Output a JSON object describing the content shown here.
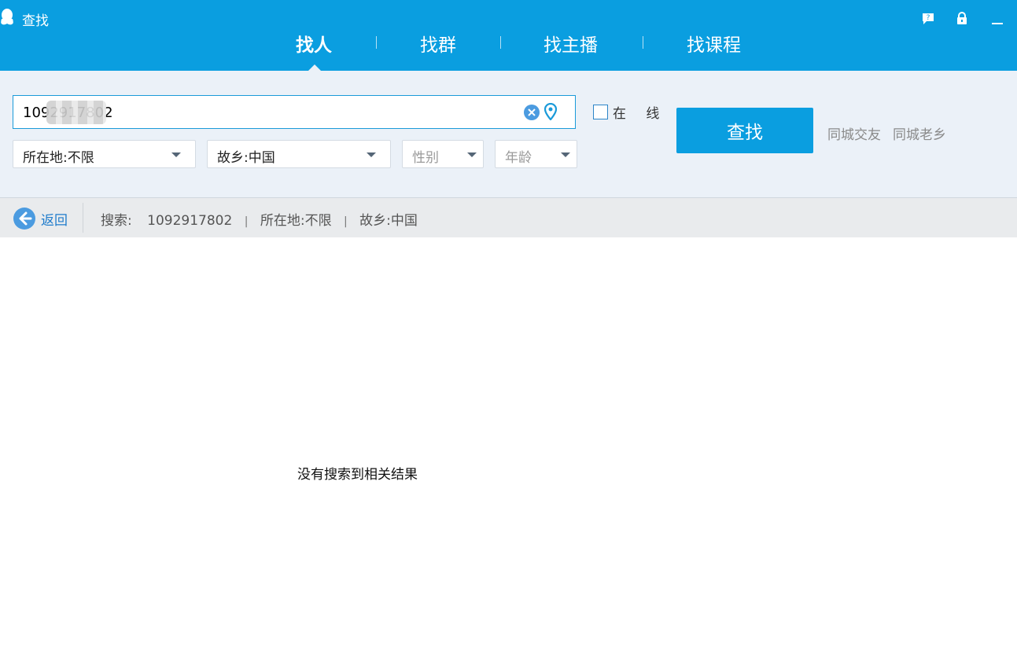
{
  "window": {
    "title": "查找",
    "buttons": [
      "feedback-icon",
      "lock-icon",
      "minimize-icon"
    ]
  },
  "tabs": [
    {
      "label": "找人",
      "active": true
    },
    {
      "label": "找群",
      "active": false
    },
    {
      "label": "找主播",
      "active": false
    },
    {
      "label": "找课程",
      "active": false
    }
  ],
  "search": {
    "value": "1092917802",
    "online_label": "在 线",
    "online_checked": false,
    "button_label": "查找",
    "links": [
      "同城交友",
      "同城老乡"
    ]
  },
  "filters": {
    "location": "所在地:不限",
    "hometown": "故乡:中国",
    "gender": "性别",
    "age": "年龄"
  },
  "breadcrumb": {
    "back_label": "返回",
    "prefix": "搜索:",
    "query": "1092917802",
    "location": "所在地:不限",
    "hometown": "故乡:中国"
  },
  "results": {
    "empty_message": "没有搜索到相关结果"
  },
  "colors": {
    "brand": "#0a9ee0",
    "panel": "#ebf1f8"
  }
}
